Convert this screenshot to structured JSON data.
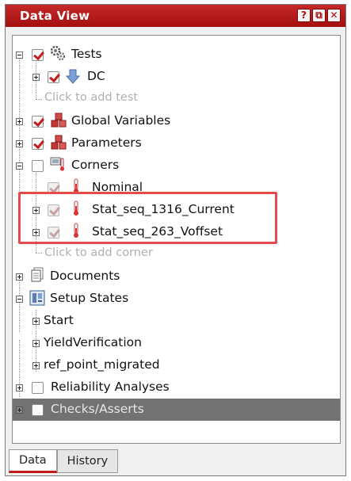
{
  "window": {
    "title": "Data View",
    "buttons": [
      "?",
      "⧉",
      "✕"
    ]
  },
  "tree": {
    "tests_label": "Tests",
    "dc_label": "DC",
    "add_test": "Click to add test",
    "global_variables": "Global Variables",
    "parameters": "Parameters",
    "corners": "Corners",
    "nominal": "Nominal",
    "corner_1": "Stat_seq_1316_Current",
    "corner_2": "Stat_seq_263_Voffset",
    "add_corner": "Click to add corner",
    "documents": "Documents",
    "setup_states": "Setup States",
    "start": "Start",
    "yield_verification": "YieldVerification",
    "ref_point": "ref_point_migrated",
    "reliability": "Reliability Analyses",
    "checks": "Checks/Asserts"
  },
  "tabs": [
    "Data",
    "History"
  ],
  "colors": {
    "accent": "#b51818",
    "highlight": "#e54b4b",
    "checks_row": "#727272"
  }
}
